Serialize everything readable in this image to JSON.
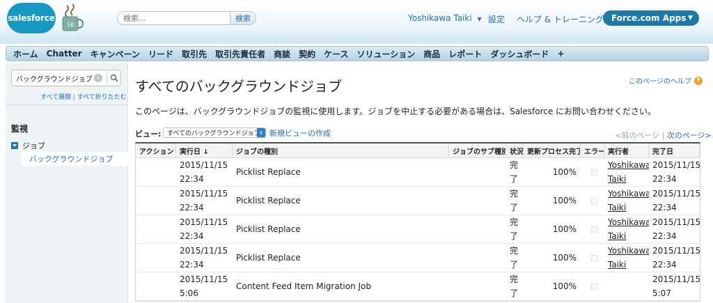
{
  "header": {
    "logo_text": "salesforce",
    "mug_number": "16",
    "search_placeholder": "検索...",
    "search_button": "検索",
    "user_menu": "Yoshikawa Taiki",
    "setup_link": "設定",
    "help_training_link": "ヘルプ & トレーニング",
    "apps_button": "Force.com Apps"
  },
  "tabs": [
    "ホーム",
    "Chatter",
    "キャンペーン",
    "リード",
    "取引先",
    "取引先責任者",
    "商談",
    "契約",
    "ケース",
    "ソリューション",
    "商品",
    "レポート",
    "ダッシュボード",
    "+"
  ],
  "sidebar": {
    "search_value": "バックグラウンドジョブ",
    "expand_all": "すべて展開",
    "collapse_all": "すべて折りたたむ",
    "section_title": "監視",
    "group_label": "ジョブ",
    "selected_item": "バックグラウンドジョブ"
  },
  "main": {
    "title": "すべてのバックグラウンドジョブ",
    "help_link": "このページのヘルプ",
    "description": "このページは、バックグラウンドジョブの監視に使用します。ジョブを中止する必要がある場合は、Salesforce にお問い合わせください。",
    "view_label": "ビュー:",
    "view_selected": "すべてのバックグラウンドジョブ",
    "new_view_link": "新規ビューの作成",
    "pager_prev": "<前のページ",
    "pager_next": "次のページ>"
  },
  "table": {
    "columns": [
      "アクション",
      "実行日 ↓",
      "ジョブの種別",
      "ジョブのサブ種別",
      "状況",
      "更新プロセス完了",
      "エラー",
      "実行者",
      "完了日"
    ],
    "rows": [
      {
        "action": "",
        "run_date": "2015/11/15\n22:34",
        "job_type": "Picklist Replace",
        "sub_type": "",
        "status": "完\n了",
        "progress": "100%",
        "user": "Yoshikawa\nTaiki",
        "completed": "2015/11/15\n22:34"
      },
      {
        "action": "",
        "run_date": "2015/11/15\n22:34",
        "job_type": "Picklist Replace",
        "sub_type": "",
        "status": "完\n了",
        "progress": "100%",
        "user": "Yoshikawa\nTaiki",
        "completed": "2015/11/15\n22:34"
      },
      {
        "action": "",
        "run_date": "2015/11/15\n22:34",
        "job_type": "Picklist Replace",
        "sub_type": "",
        "status": "完\n了",
        "progress": "100%",
        "user": "Yoshikawa\nTaiki",
        "completed": "2015/11/15\n22:34"
      },
      {
        "action": "",
        "run_date": "2015/11/15\n22:34",
        "job_type": "Picklist Replace",
        "sub_type": "",
        "status": "完\n了",
        "progress": "100%",
        "user": "Yoshikawa\nTaiki",
        "completed": "2015/11/15\n22:34"
      },
      {
        "action": "",
        "run_date": "2015/11/15\n5:06",
        "job_type": "Content Feed Item Migration Job",
        "sub_type": "",
        "status": "完\n了",
        "progress": "100%",
        "user": "",
        "completed": "2015/11/15\n5:07"
      }
    ]
  },
  "colors": {
    "brand_blue": "#1798c1",
    "link_blue": "#236fbd",
    "apps_button": "#1e78a8",
    "help_orange": "#f0a21e"
  }
}
